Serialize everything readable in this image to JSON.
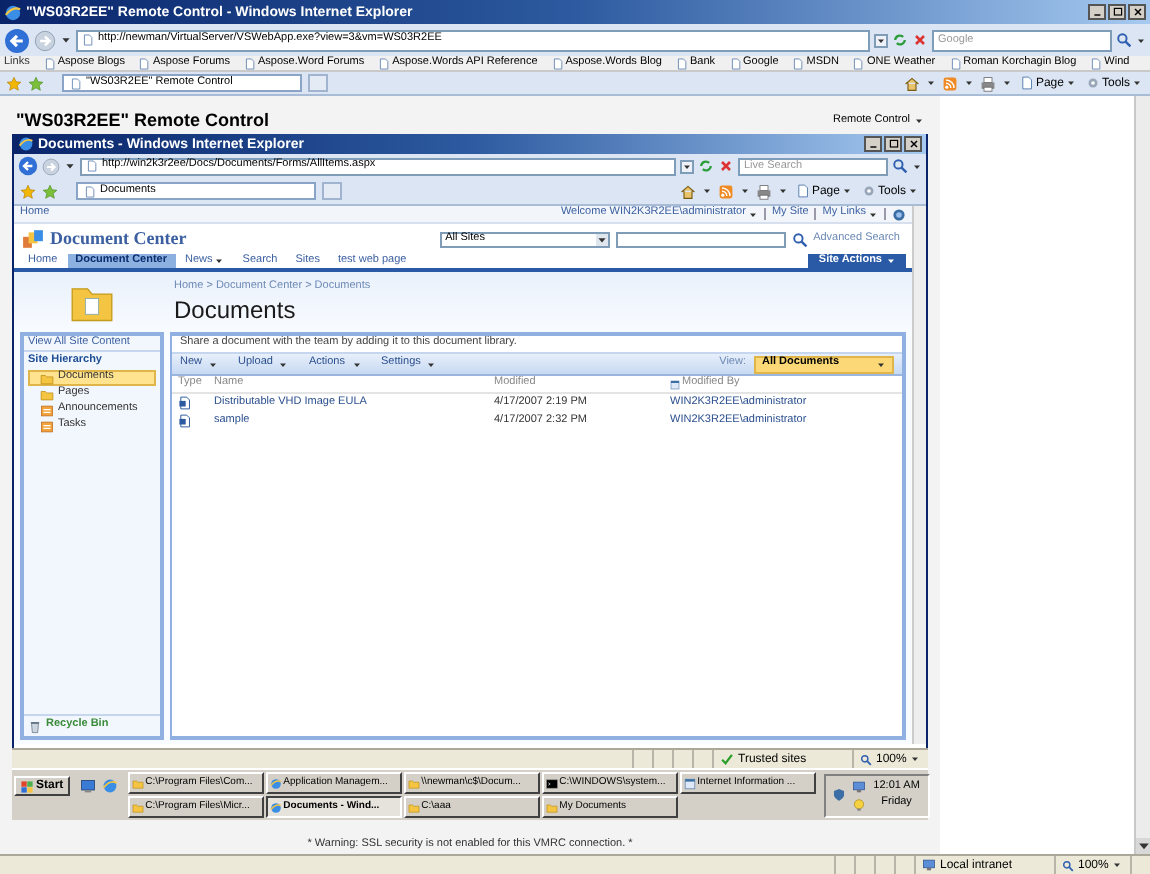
{
  "window": {
    "title": "\"WS03R2EE\" Remote Control - Windows Internet Explorer",
    "address": "http://newman/VirtualServer/VSWebApp.exe?view=3&vm=WS03R2EE",
    "search_placeholder": "Google",
    "links_label": "Links",
    "links": [
      "Aspose Blogs",
      "Aspose Forums",
      "Aspose.Word Forums",
      "Aspose.Words API Reference",
      "Aspose.Words Blog",
      "Bank",
      "Google",
      "MSDN",
      "ONE Weather",
      "Roman Korchagin Blog",
      "Wind"
    ],
    "tabs": [
      {
        "label": "\"WS03R2EE\" Remote Control",
        "selected": true
      }
    ],
    "commands": [
      {
        "kind": "page",
        "label": "Page"
      },
      {
        "kind": "tools",
        "label": "Tools"
      }
    ],
    "status": {
      "kind": "intranet",
      "zone": "Local intranet",
      "zoom": "100%"
    }
  },
  "remote": {
    "title": "\"WS03R2EE\" Remote Control",
    "menu": "Remote Control"
  },
  "inner_window": {
    "title": "Documents - Windows Internet Explorer",
    "address": "http://win2k3r2ee/Docs/Documents/Forms/AllItems.aspx",
    "search_placeholder": "Live Search",
    "tabs": [
      {
        "label": "Documents",
        "selected": true
      }
    ],
    "commands": [
      {
        "kind": "page",
        "label": "Page"
      },
      {
        "kind": "tools",
        "label": "Tools"
      }
    ],
    "status": {
      "kind": "trusted",
      "zone": "Trusted sites",
      "zoom": "100%"
    }
  },
  "sharepoint": {
    "home": "Home",
    "welcome": "Welcome WIN2K3R2EE\\administrator",
    "my_site": "My Site",
    "my_links": "My Links",
    "site_title": "Document Center",
    "scope": "All Sites",
    "advanced_search": "Advanced Search",
    "nav": [
      {
        "label": "Home",
        "selected": false,
        "dropdown": false
      },
      {
        "label": "Document Center",
        "selected": true,
        "dropdown": false
      },
      {
        "label": "News",
        "selected": false,
        "dropdown": true
      },
      {
        "label": "Search",
        "selected": false,
        "dropdown": false
      },
      {
        "label": "Sites",
        "selected": false,
        "dropdown": false
      },
      {
        "label": "test web page",
        "selected": false,
        "dropdown": false
      }
    ],
    "site_actions": "Site Actions",
    "breadcrumb": "Home > Document Center > Documents",
    "page_title": "Documents",
    "view_all": "View All Site Content",
    "hierarchy": "Site Hierarchy",
    "sidebar": [
      {
        "label": "Documents",
        "kind": "library",
        "selected": true
      },
      {
        "label": "Pages",
        "kind": "library",
        "selected": false
      },
      {
        "label": "Announcements",
        "kind": "list",
        "selected": false
      },
      {
        "label": "Tasks",
        "kind": "list",
        "selected": false
      }
    ],
    "recycle_bin": "Recycle Bin",
    "description": "Share a document with the team by adding it to this document library.",
    "toolbar": [
      "New",
      "Upload",
      "Actions",
      "Settings"
    ],
    "view_label": "View:",
    "view": "All Documents",
    "columns": [
      "Type",
      "Name",
      "Modified",
      "Modified By"
    ],
    "rows": [
      {
        "name": "Distributable VHD Image EULA",
        "modified": "4/17/2007 2:19 PM",
        "modified_by": "WIN2K3R2EE\\administrator"
      },
      {
        "name": "sample",
        "modified": "4/17/2007 2:32 PM",
        "modified_by": "WIN2K3R2EE\\administrator"
      }
    ]
  },
  "taskbar": {
    "start": "Start",
    "rows": [
      [
        {
          "label": "C:\\Program Files\\Com...",
          "kind": "folder",
          "selected": false
        },
        {
          "label": "Application Managem...",
          "kind": "browser",
          "selected": false
        },
        {
          "label": "\\\\newman\\c$\\Docum...",
          "kind": "folder",
          "selected": false
        },
        {
          "label": "C:\\WINDOWS\\system...",
          "kind": "console",
          "selected": false
        },
        {
          "label": "Internet Information ...",
          "kind": "window",
          "selected": false
        }
      ],
      [
        {
          "label": "C:\\Program Files\\Micr...",
          "kind": "folder",
          "selected": false
        },
        {
          "label": "Documents - Wind...",
          "kind": "browser",
          "selected": true
        },
        {
          "label": "C:\\aaa",
          "kind": "folder",
          "selected": false
        },
        {
          "label": "My Documents",
          "kind": "folder",
          "selected": false
        }
      ]
    ],
    "time": "12:01 AM",
    "day": "Friday"
  },
  "warning": "* Warning: SSL security is not enabled for this VMRC connection. *"
}
